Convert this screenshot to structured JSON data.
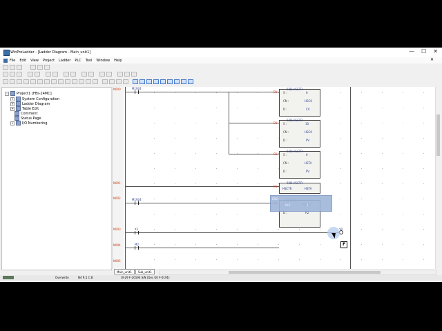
{
  "window": {
    "title": "WinProLadder - [Ladder Diagram - Main_unit1]",
    "controls": [
      "—",
      "☐",
      "✕"
    ]
  },
  "menu": [
    "File",
    "Edit",
    "View",
    "Project",
    "Ladder",
    "PLC",
    "Tool",
    "Window",
    "Help"
  ],
  "tree": {
    "root": "Project1 [FBs-24MC]",
    "items": [
      "System Configuration",
      "Ladder Diagram",
      "Table Edit",
      "Comment",
      "Status Page",
      "I/O Numbering"
    ]
  },
  "networks": [
    "N000",
    "N001",
    "N002",
    "N003",
    "N004",
    "N005"
  ],
  "contacts": [
    "M1924",
    "M1924",
    "X1",
    "M2"
  ],
  "blocks": [
    {
      "name": "93D.HSCTR",
      "s": "0",
      "cn": "HSC0",
      "d": "CV"
    },
    {
      "name": "93D.HSCTR",
      "s": "10",
      "cn": "HSC0",
      "d": "PV"
    },
    {
      "name": "93D.HSCTR",
      "s": "0",
      "cn": "HSTA",
      "d": "PV"
    },
    {
      "name": "93D.HSCTR",
      "s": "HSCTR",
      "cn": "HSTA",
      "d": ""
    },
    {
      "name": "08.MOV",
      "s": "R4152",
      "cn": "",
      "d": "R2"
    }
  ],
  "labels": {
    "s": "S :",
    "cn": "CN :",
    "d": "D :",
    "en": "EN"
  },
  "coil": "Y0",
  "tabs": [
    "Main_unit1",
    "Sub_unit1"
  ],
  "status": {
    "mode": "Overwrite",
    "pos": "N4 R:1 C:8",
    "info": "UI-29 F-20194 S/N (Dec U0 F-0191)"
  },
  "overlay_text": [
    "ENO",
    "XXX",
    "1"
  ],
  "fkey": "F"
}
